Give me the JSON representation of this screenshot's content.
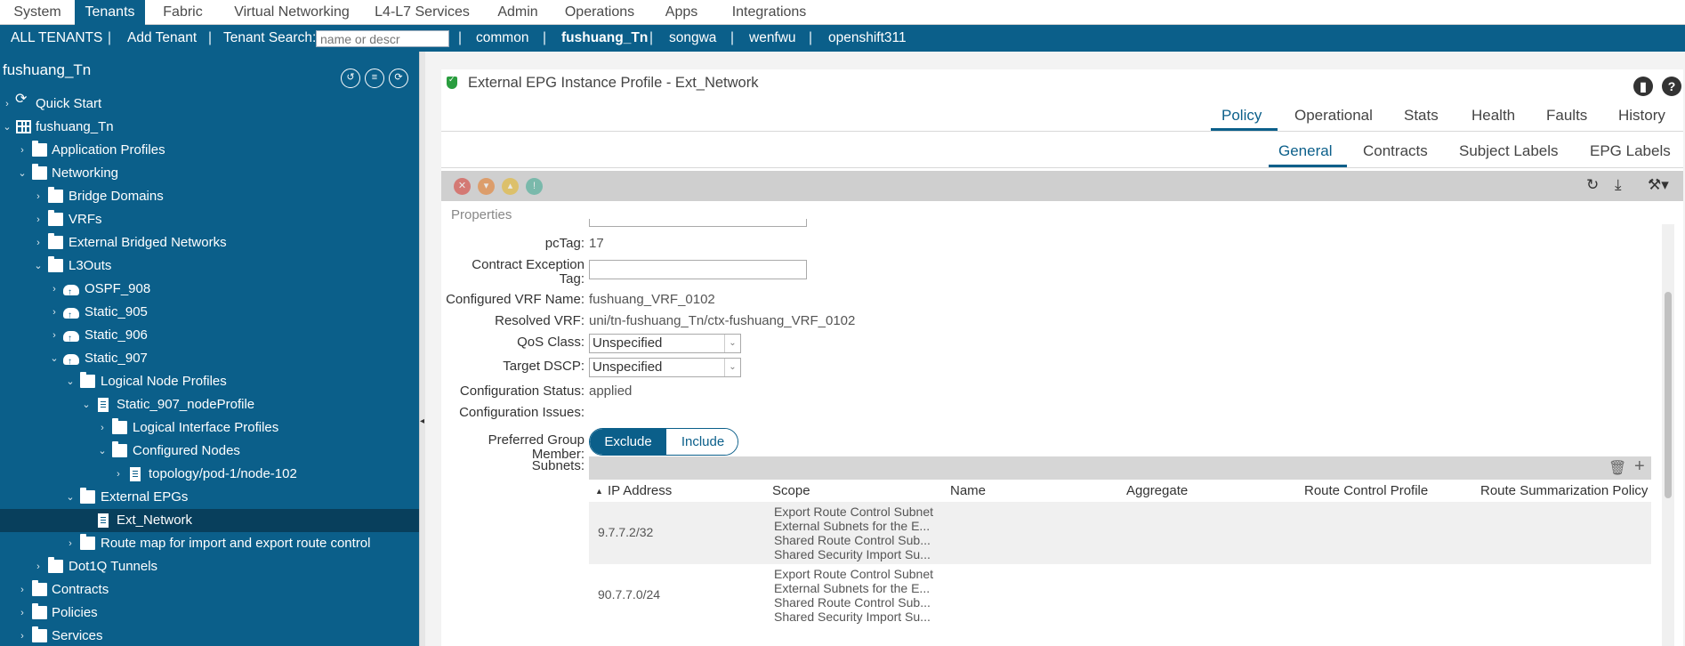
{
  "top_menu": [
    "System",
    "Tenants",
    "Fabric",
    "Virtual Networking",
    "L4-L7 Services",
    "Admin",
    "Operations",
    "Apps",
    "Integrations"
  ],
  "tenant_bar": {
    "all_tenants": "ALL TENANTS",
    "add_tenant": "Add Tenant",
    "tenant_search_label": "Tenant Search:",
    "search_placeholder": "name or descr",
    "tenants": [
      "common",
      "fushuang_Tn",
      "songwa",
      "wenfwu",
      "openshift311"
    ]
  },
  "sidebar": {
    "title": "fushuang_Tn",
    "tree": [
      {
        "label": "Quick Start"
      },
      {
        "label": "fushuang_Tn"
      },
      {
        "label": "Application Profiles"
      },
      {
        "label": "Networking"
      },
      {
        "label": "Bridge Domains"
      },
      {
        "label": "VRFs"
      },
      {
        "label": "External Bridged Networks"
      },
      {
        "label": "L3Outs"
      },
      {
        "label": "OSPF_908"
      },
      {
        "label": "Static_905"
      },
      {
        "label": "Static_906"
      },
      {
        "label": "Static_907"
      },
      {
        "label": "Logical Node Profiles"
      },
      {
        "label": "Static_907_nodeProfile"
      },
      {
        "label": "Logical Interface Profiles"
      },
      {
        "label": "Configured Nodes"
      },
      {
        "label": "topology/pod-1/node-102"
      },
      {
        "label": "External EPGs"
      },
      {
        "label": "Ext_Network"
      },
      {
        "label": "Route map for import and export route control"
      },
      {
        "label": "Dot1Q Tunnels"
      },
      {
        "label": "Contracts"
      },
      {
        "label": "Policies"
      },
      {
        "label": "Services"
      }
    ]
  },
  "main": {
    "title": "External EPG Instance Profile - Ext_Network",
    "tabs": [
      "Policy",
      "Operational",
      "Stats",
      "Health",
      "Faults",
      "History"
    ],
    "subtabs": [
      "General",
      "Contracts",
      "Subject Labels",
      "EPG Labels"
    ],
    "section": "Properties",
    "fields": {
      "pctag_label": "pcTag:",
      "pctag_value": "17",
      "contract_exception_label_1": "Contract Exception",
      "contract_exception_label_2": "Tag:",
      "configured_vrf_label": "Configured VRF Name:",
      "configured_vrf_value": "fushuang_VRF_0102",
      "resolved_vrf_label": "Resolved VRF:",
      "resolved_vrf_value": "uni/tn-fushuang_Tn/ctx-fushuang_VRF_0102",
      "qos_label": "QoS Class:",
      "qos_value": "Unspecified",
      "dscp_label": "Target DSCP:",
      "dscp_value": "Unspecified",
      "config_status_label": "Configuration Status:",
      "config_status_value": "applied",
      "config_issues_label": "Configuration Issues:",
      "pref_group_label_1": "Preferred Group",
      "pref_group_label_2": "Member:",
      "pref_exclude": "Exclude",
      "pref_include": "Include",
      "subnets_label": "Subnets:"
    },
    "subnets_table": {
      "columns": [
        "IP Address",
        "Scope",
        "Name",
        "Aggregate",
        "Route Control Profile",
        "Route Summarization Policy"
      ],
      "rows": [
        {
          "ip": "9.7.7.2/32",
          "scope": [
            "Export Route Control Subnet",
            "External Subnets for the E...",
            "Shared Route Control Sub...",
            "Shared Security Import Su..."
          ]
        },
        {
          "ip": "90.7.7.0/24",
          "scope": [
            "Export Route Control Subnet",
            "External Subnets for the E...",
            "Shared Route Control Sub...",
            "Shared Security Import Su..."
          ]
        }
      ]
    }
  },
  "colors": {
    "brand": "#0b5f8a",
    "selected_row": "#083f5c",
    "health_ok": "#2a9d3f"
  }
}
